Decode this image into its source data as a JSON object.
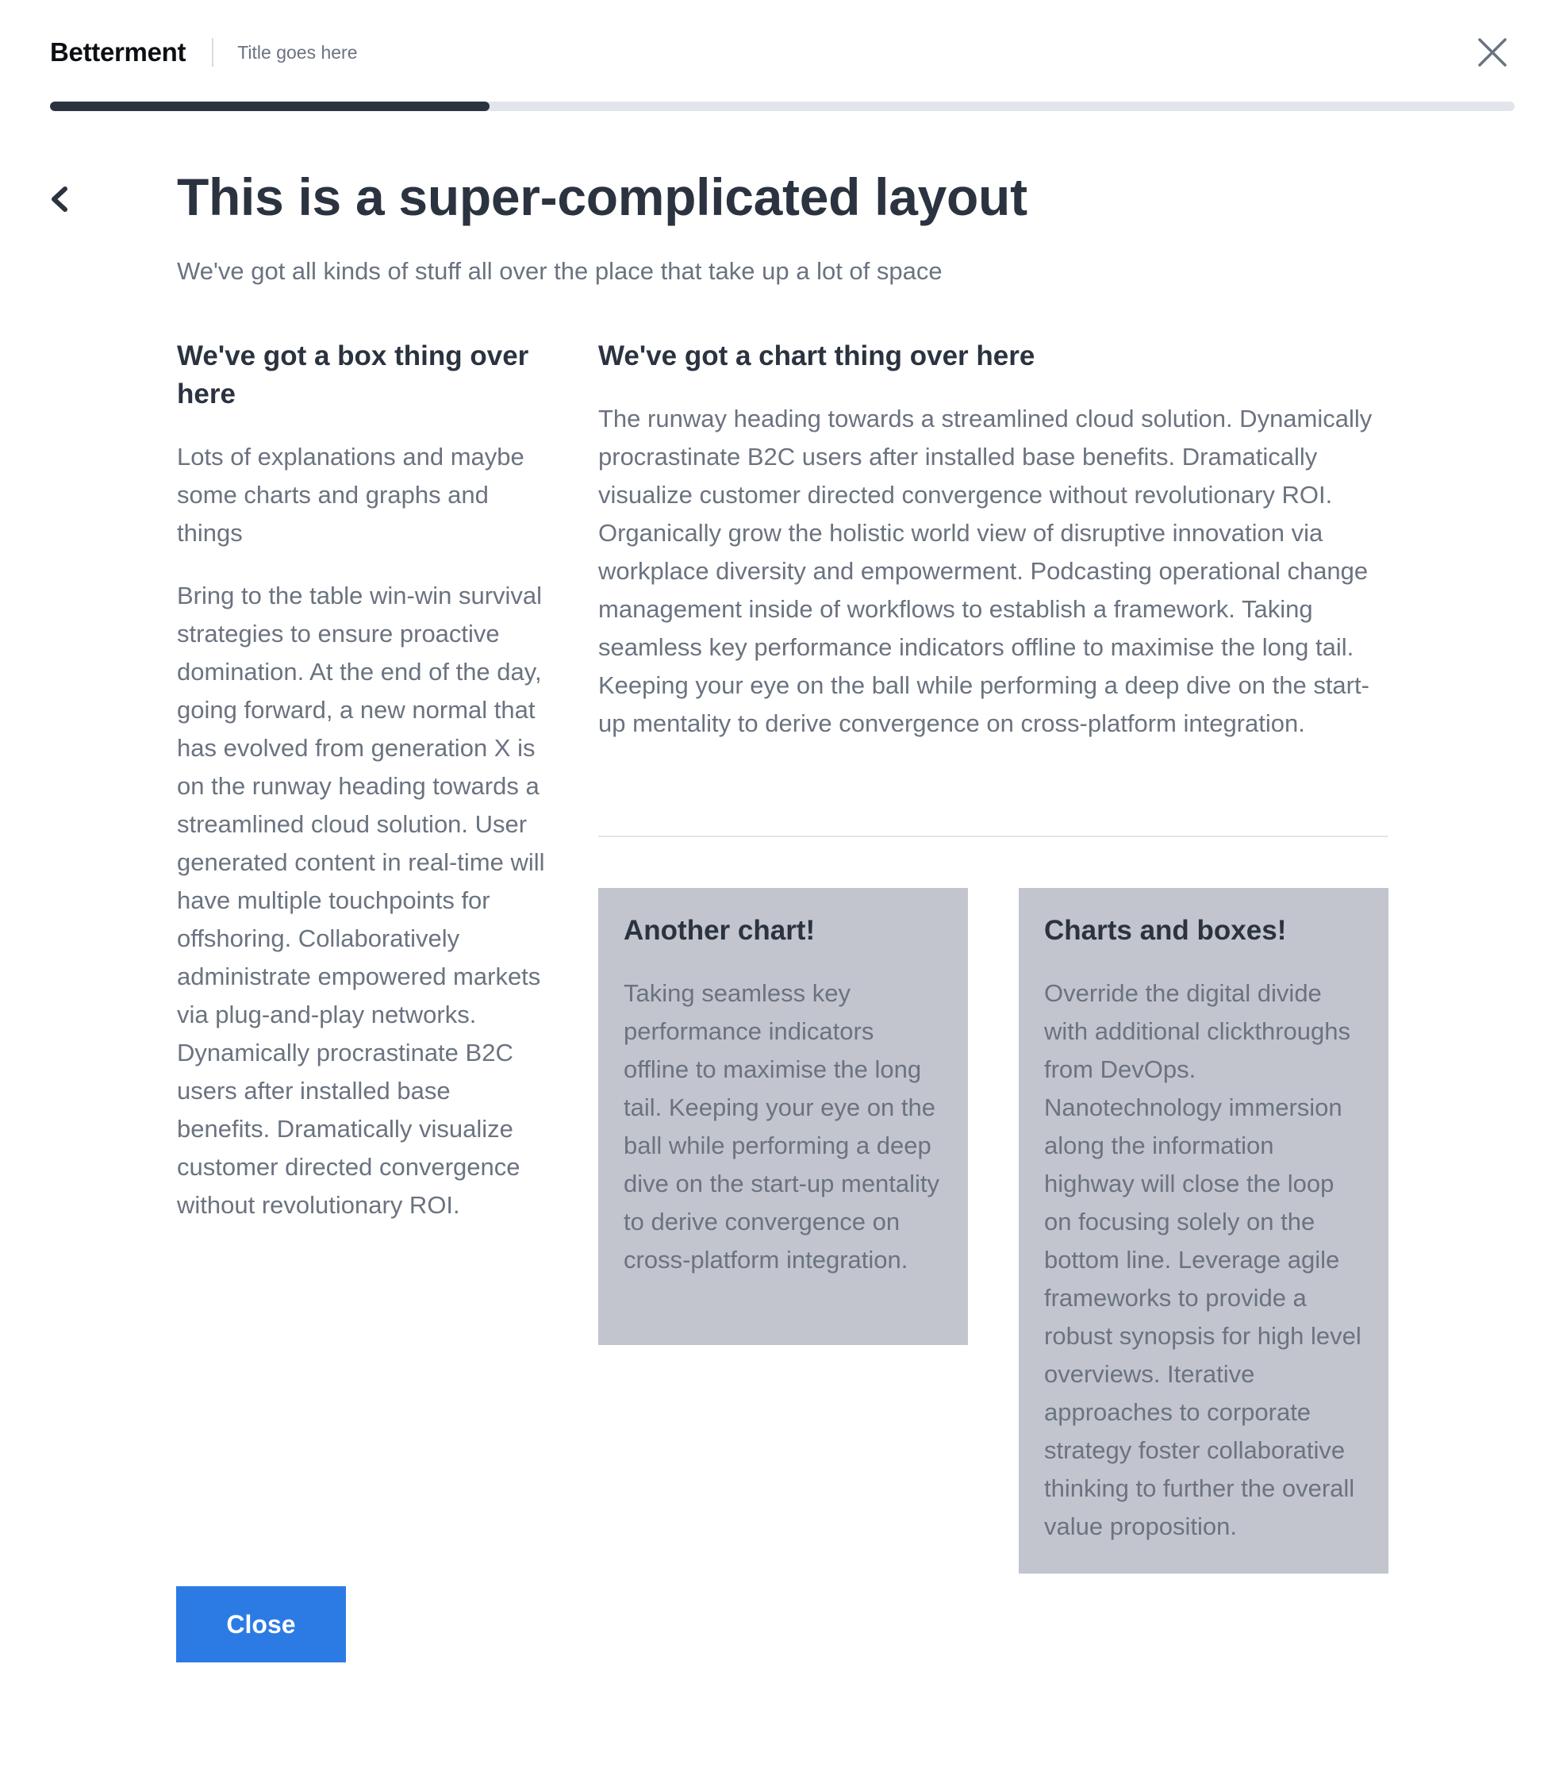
{
  "header": {
    "brand": "Betterment",
    "title": "Title goes here"
  },
  "progress": {
    "value_percent": 30
  },
  "icons": {
    "close": "close-x-icon",
    "back": "chevron-left-icon"
  },
  "main": {
    "title": "This is a super-complicated layout",
    "subtitle": "We've got all kinds of stuff all over the place that take up a lot of space"
  },
  "left": {
    "heading": "We've got a box thing over here",
    "para1": "Lots of explanations and maybe some charts and graphs and things",
    "para2": "Bring to the table win-win survival strategies to ensure proactive domination. At the end of the day, going forward, a new normal that has evolved from generation X is on the runway heading towards a streamlined cloud solution. User generated content in real-time will have multiple touchpoints for offshoring. Collaboratively administrate empowered markets via plug-and-play networks. Dynamically procrastinate B2C users after installed base benefits. Dramatically visualize customer directed convergence without revolutionary ROI."
  },
  "right": {
    "heading": "We've got a chart thing over here",
    "para": "The runway heading towards a streamlined cloud solution. Dynamically procrastinate B2C users after installed base benefits. Dramatically visualize customer directed convergence without revolutionary ROI. Organically grow the holistic world view of disruptive innovation via workplace diversity and empowerment. Podcasting operational change management inside of workflows to establish a framework. Taking seamless key performance indicators offline to maximise the long tail. Keeping your eye on the ball while performing a deep dive on the start-up mentality to derive convergence on cross-platform integration."
  },
  "cards": [
    {
      "heading": "Another chart!",
      "text": "Taking seamless key performance indicators offline to maximise the long tail. Keeping your eye on the ball while performing a deep dive on the start-up mentality to derive convergence on cross-platform integration."
    },
    {
      "heading": "Charts and boxes!",
      "text": "Override the digital divide with additional clickthroughs from DevOps. Nanotechnology immersion along the information highway will close the loop on focusing solely on the bottom line. Leverage agile frameworks to provide a robust synopsis for high level overviews. Iterative approaches to corporate strategy foster collaborative thinking to further the overall value proposition."
    }
  ],
  "footer": {
    "close_label": "Close"
  },
  "colors": {
    "primary_button": "#2c7be5",
    "progress_fill": "#2b3340",
    "progress_track": "#e2e5e9",
    "card_bg": "#c2c5ce",
    "text_dark": "#2b3340",
    "text_muted": "#6b7380"
  }
}
